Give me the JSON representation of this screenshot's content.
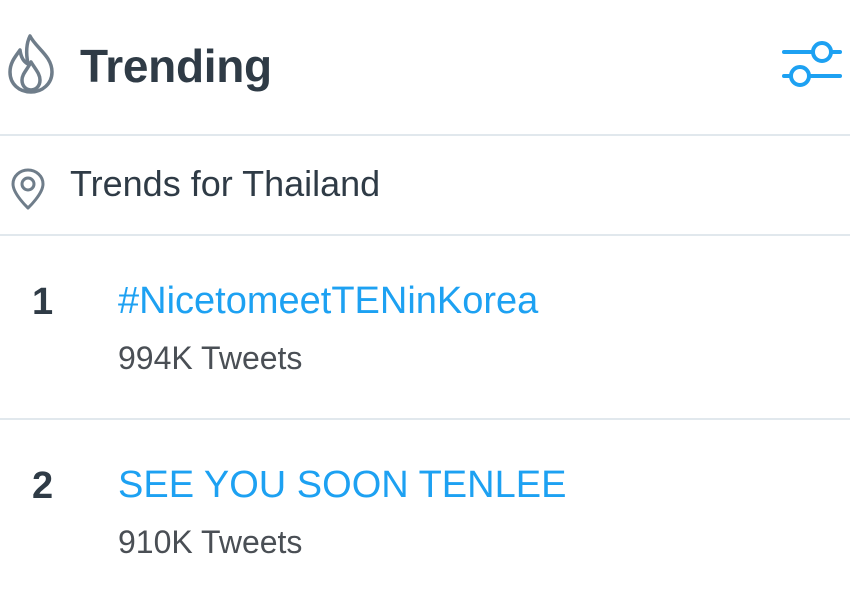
{
  "header": {
    "title": "Trending",
    "icon": "flame-icon",
    "settings_icon": "settings-sliders-icon"
  },
  "location": {
    "icon": "location-pin-icon",
    "label": "Trends for Thailand"
  },
  "trends": [
    {
      "rank": "1",
      "name": "#NicetomeetTENinKorea",
      "count": "994K Tweets"
    },
    {
      "rank": "2",
      "name": "SEE YOU SOON TENLEE",
      "count": "910K Tweets"
    }
  ],
  "colors": {
    "accent": "#1da1f2",
    "text": "#2f3b46",
    "divider": "#e1e8ed"
  }
}
